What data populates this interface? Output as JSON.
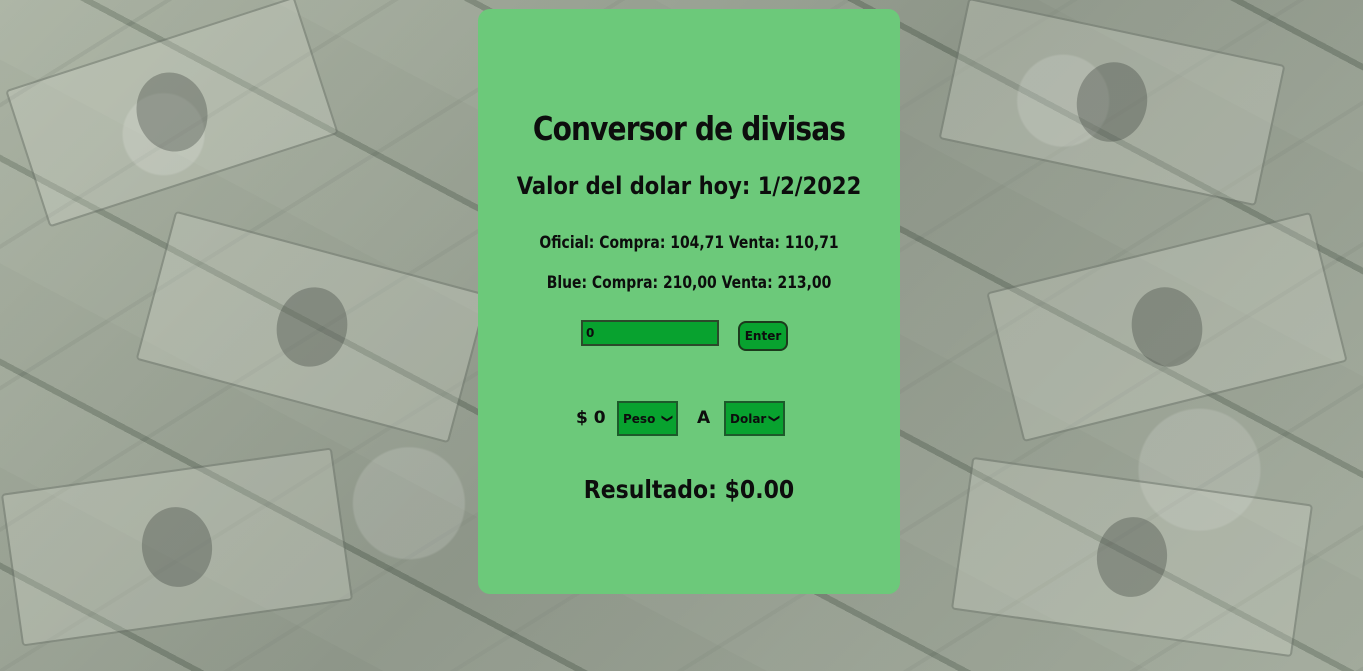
{
  "converter": {
    "title": "Conversor de divisas",
    "rate_heading_label": "Valor del dolar hoy:",
    "rate_date": "1/2/2022",
    "oficial": {
      "label": "Oficial:",
      "compra_label": "Compra:",
      "compra_value": "104,71",
      "venta_label": "Venta:",
      "venta_value": "110,71"
    },
    "blue": {
      "label": "Blue:",
      "compra_label": "Compra:",
      "compra_value": "210,00",
      "venta_label": "Venta:",
      "venta_value": "213,00"
    },
    "amount_input_value": "0",
    "enter_button_label": "Enter",
    "amount_prefix": "$",
    "amount_display": "0",
    "from_currency": "Peso",
    "to_label": "A",
    "to_currency": "Dolar",
    "result_label": "Resultado:",
    "result_value": "$0.00"
  },
  "colors": {
    "card_background": "#6cc97a",
    "control_background": "#08a22f",
    "text": "#0d0d0d"
  }
}
